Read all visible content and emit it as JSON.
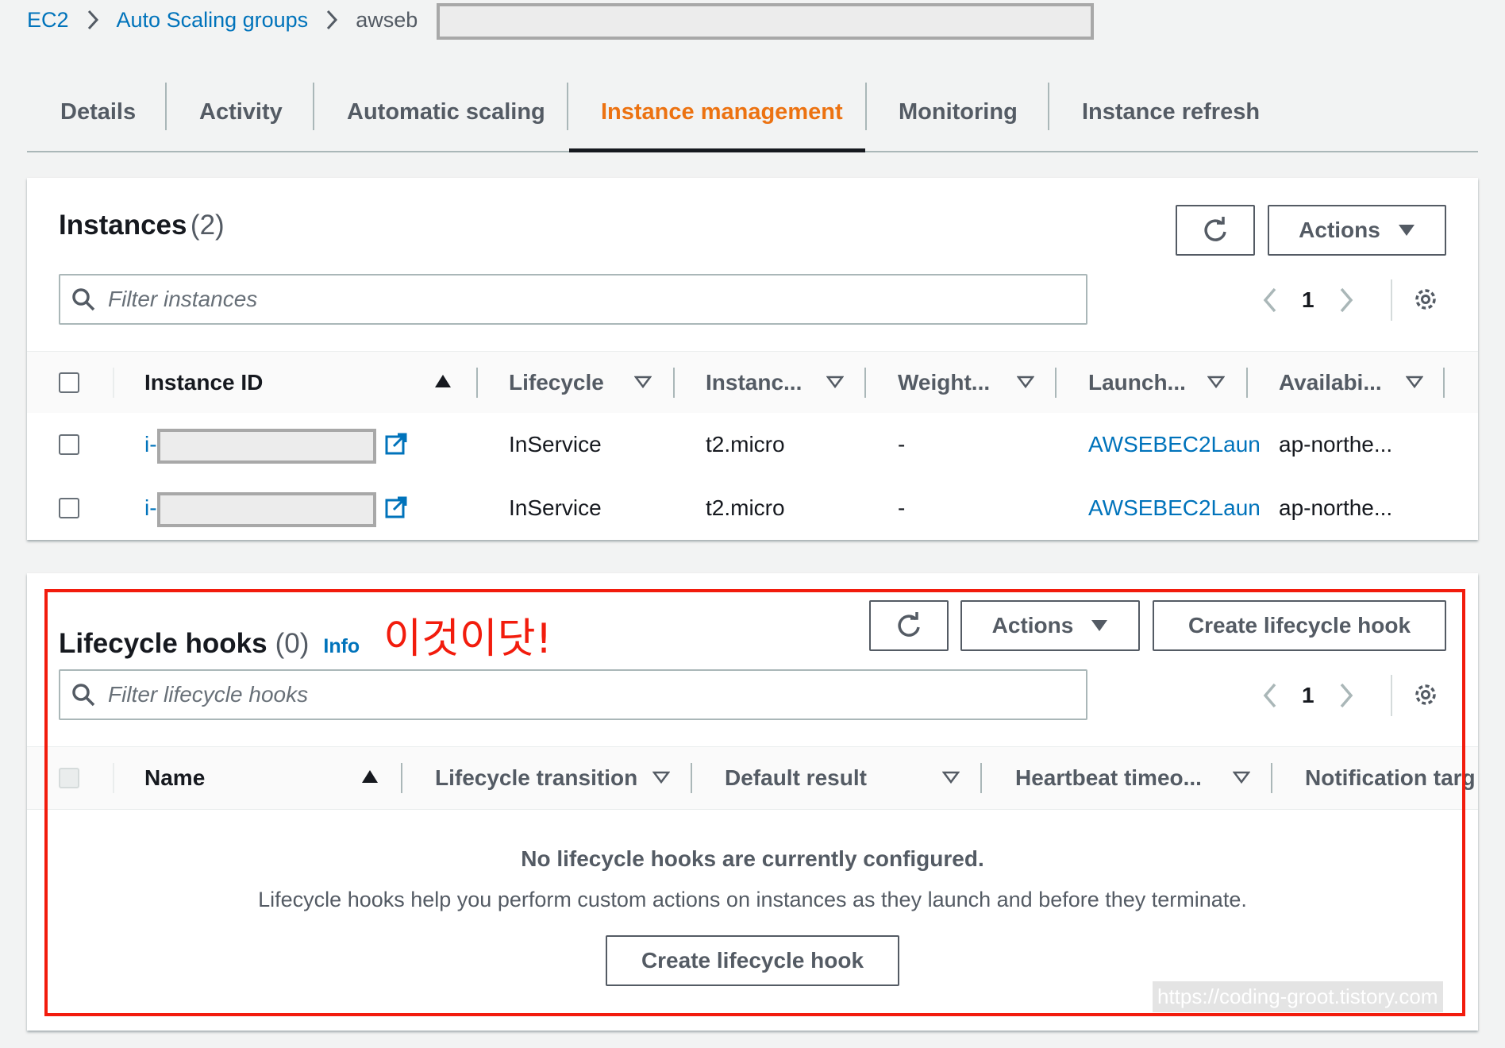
{
  "breadcrumb": {
    "ec2": "EC2",
    "asg": "Auto Scaling groups",
    "current": "awseb"
  },
  "tabs": [
    {
      "label": "Details",
      "active": false
    },
    {
      "label": "Activity",
      "active": false
    },
    {
      "label": "Automatic scaling",
      "active": false
    },
    {
      "label": "Instance management",
      "active": true
    },
    {
      "label": "Monitoring",
      "active": false
    },
    {
      "label": "Instance refresh",
      "active": false
    }
  ],
  "instances": {
    "title": "Instances",
    "count": "(2)",
    "refresh_icon": "refresh-icon",
    "actions_label": "Actions",
    "filter_placeholder": "Filter instances",
    "page": "1",
    "columns": [
      "Instance ID",
      "Lifecycle",
      "Instanc...",
      "Weight...",
      "Launch...",
      "Availabi..."
    ],
    "rows": [
      {
        "id_prefix": "i-",
        "lifecycle": "InService",
        "type": "t2.micro",
        "weight": "-",
        "launch": "AWSEBEC2Laun",
        "az": "ap-northe..."
      },
      {
        "id_prefix": "i-",
        "lifecycle": "InService",
        "type": "t2.micro",
        "weight": "-",
        "launch": "AWSEBEC2Laun",
        "az": "ap-northe..."
      }
    ]
  },
  "hooks": {
    "title": "Lifecycle hooks",
    "count": "(0)",
    "info": "Info",
    "annotation": "이것이닷!",
    "actions_label": "Actions",
    "create_label": "Create lifecycle hook",
    "filter_placeholder": "Filter lifecycle hooks",
    "page": "1",
    "columns": [
      "Name",
      "Lifecycle transition",
      "Default result",
      "Heartbeat timeo...",
      "Notification targ"
    ],
    "empty_title": "No lifecycle hooks are currently configured.",
    "empty_desc": "Lifecycle hooks help you perform custom actions on instances as they launch and before they terminate.",
    "empty_button": "Create lifecycle hook"
  },
  "watermark": "https://coding-groot.tistory.com",
  "colors": {
    "link": "#0073bb",
    "active_tab": "#ec7211",
    "annotation": "#f21c0d",
    "text_secondary": "#545b64"
  }
}
